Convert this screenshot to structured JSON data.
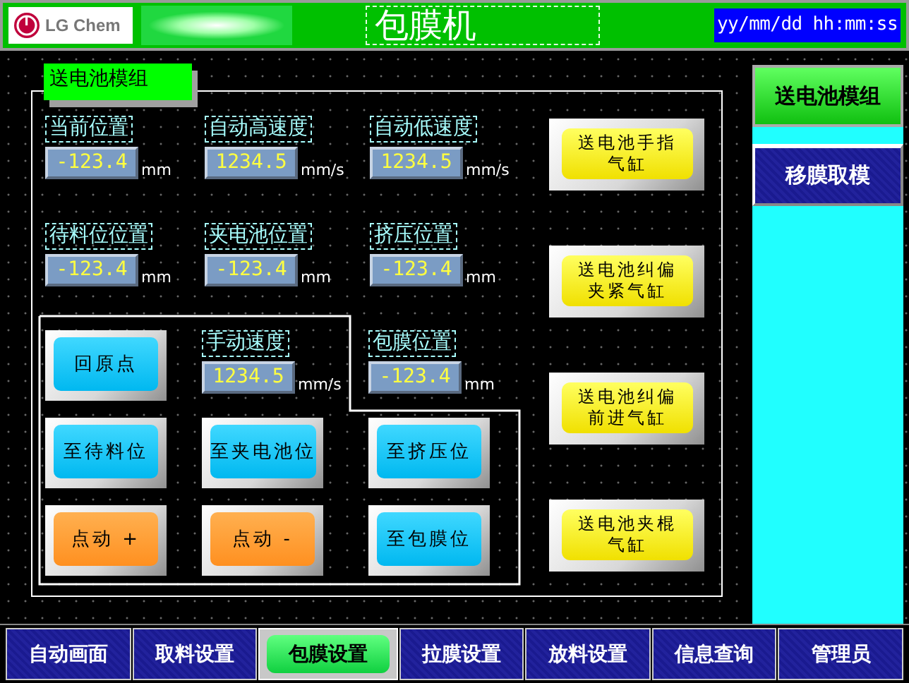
{
  "header": {
    "logo": "LG Chem",
    "title": "包膜机",
    "datetime": "yy/mm/dd hh:mm:ss"
  },
  "group_title": "送电池模组",
  "fields": [
    {
      "label": "当前位置",
      "value": "-123.4",
      "unit": "mm"
    },
    {
      "label": "自动高速度",
      "value": "1234.5",
      "unit": "mm/s"
    },
    {
      "label": "自动低速度",
      "value": "1234.5",
      "unit": "mm/s"
    },
    {
      "label": "待料位位置",
      "value": "-123.4",
      "unit": "mm"
    },
    {
      "label": "夹电池位置",
      "value": "-123.4",
      "unit": "mm"
    },
    {
      "label": "挤压位置",
      "value": "-123.4",
      "unit": "mm"
    }
  ],
  "home_button": "回原点",
  "manual_fields": [
    {
      "label": "手动速度",
      "value": "1234.5",
      "unit": "mm/s"
    },
    {
      "label": "包膜位置",
      "value": "-123.4",
      "unit": "mm"
    }
  ],
  "move_buttons": [
    {
      "label": "至待料位",
      "kind": "position"
    },
    {
      "label": "至夹电池位",
      "kind": "position"
    },
    {
      "label": "至挤压位",
      "kind": "position"
    },
    {
      "label": "点动 +",
      "kind": "jog"
    },
    {
      "label": "点动 -",
      "kind": "jog"
    },
    {
      "label": "至包膜位",
      "kind": "position"
    }
  ],
  "cylinder_buttons": [
    {
      "lines": [
        "送电池手指",
        "气缸"
      ]
    },
    {
      "lines": [
        "送电池纠偏",
        "夹紧气缸"
      ]
    },
    {
      "lines": [
        "送电池纠偏",
        "前进气缸"
      ]
    },
    {
      "lines": [
        "送电池夹棍",
        "气缸"
      ]
    }
  ],
  "side_menu": [
    {
      "label": "送电池模组",
      "selected": true
    },
    {
      "label": "移膜取模",
      "selected": false
    }
  ],
  "nav_tabs": [
    {
      "label": "自动画面",
      "selected": false
    },
    {
      "label": "取料设置",
      "selected": false
    },
    {
      "label": "包膜设置",
      "selected": true
    },
    {
      "label": "拉膜设置",
      "selected": false
    },
    {
      "label": "放料设置",
      "selected": false
    },
    {
      "label": "信息查询",
      "selected": false
    },
    {
      "label": "管理员",
      "selected": false
    }
  ]
}
